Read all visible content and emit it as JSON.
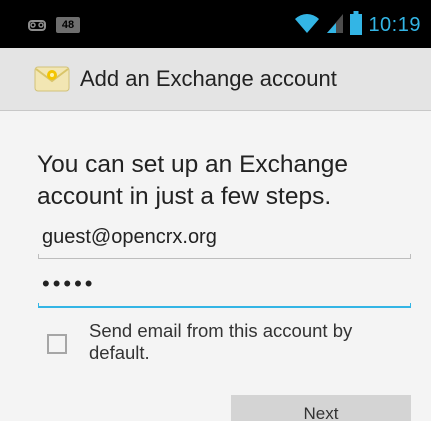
{
  "status_bar": {
    "notification_badge": "48",
    "time": "10:19",
    "icons": [
      "voicemail-icon",
      "wifi-icon",
      "signal-icon",
      "battery-icon"
    ],
    "time_color": "#33b5e5"
  },
  "action_bar": {
    "icon": "email-icon",
    "title": "Add an Exchange account"
  },
  "form": {
    "intro": "You can set up an Exchange account in just a few steps.",
    "email_value": "guest@opencrx.org",
    "password_value": "•••••",
    "default_account_label": "Send email from this account by default.",
    "default_account_checked": false,
    "next_label": "Next"
  },
  "colors": {
    "accent": "#33b5e5",
    "action_bar_bg": "#e4e4e4",
    "content_bg": "#f4f4f4"
  }
}
